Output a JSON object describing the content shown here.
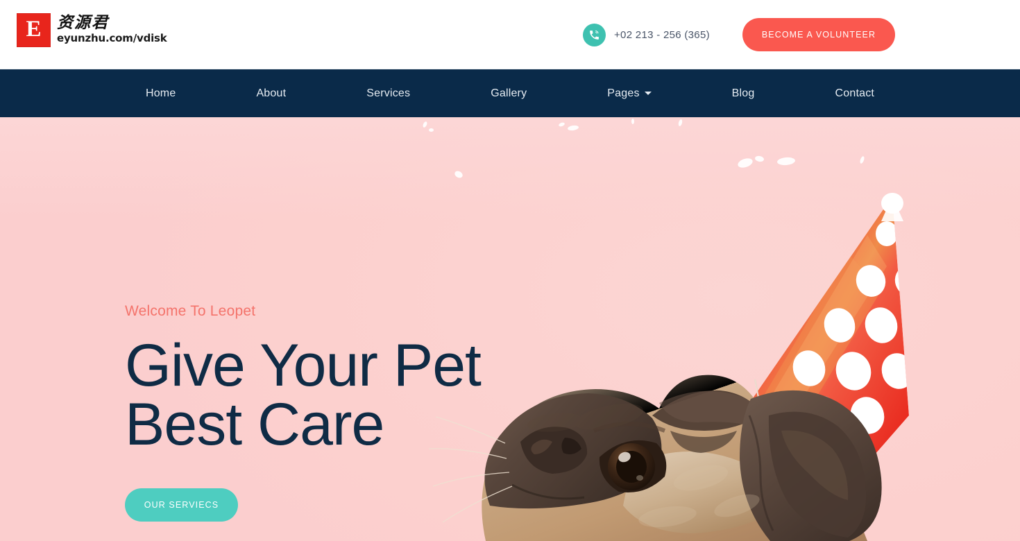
{
  "topbar": {
    "logo": {
      "mark_letter": "E",
      "brand_cn": "资源君",
      "brand_url": "eyunzhu.com/vdisk"
    },
    "phone_icon": "phone-call-icon",
    "phone_number": "+02 213 - 256 (365)",
    "volunteer_button": "BECOME A VOLUNTEER"
  },
  "nav": {
    "items": [
      {
        "label": "Home",
        "has_dropdown": false
      },
      {
        "label": "About",
        "has_dropdown": false
      },
      {
        "label": "Services",
        "has_dropdown": false
      },
      {
        "label": "Gallery",
        "has_dropdown": false
      },
      {
        "label": "Pages",
        "has_dropdown": true
      },
      {
        "label": "Blog",
        "has_dropdown": false
      },
      {
        "label": "Contact",
        "has_dropdown": false
      }
    ]
  },
  "hero": {
    "eyebrow": "Welcome To Leopet",
    "headline": "Give Your Pet\nBest Care",
    "cta_button": "OUR SERVIECS",
    "image_alt": "pug-dog-with-red-polka-dot-party-hat"
  },
  "colors": {
    "accent_coral": "#fa584f",
    "accent_teal": "#4ecdc0",
    "nav_navy": "#0a2a49",
    "hero_pink": "#fcd0ce",
    "headline_navy": "#0f2b45",
    "eyebrow_coral": "#f4736b",
    "logo_red": "#e8251c",
    "hat_red": "#f23a2e"
  }
}
